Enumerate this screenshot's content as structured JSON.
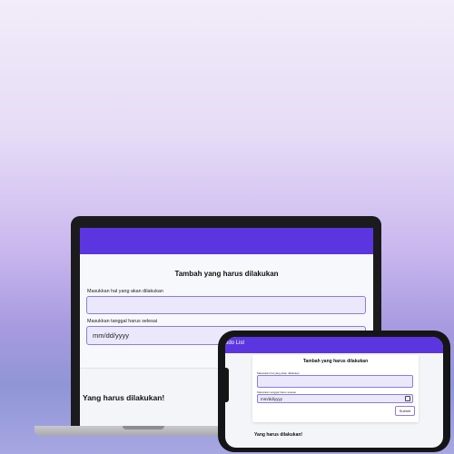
{
  "laptop": {
    "form_title": "Tambah yang harus dilakukan",
    "task_label": "Masukkan hal yang akan dilakukan",
    "task_value": "",
    "date_label": "Masukkan tanggal harus selesai",
    "date_placeholder": "mm/dd/yyyy",
    "list_title": "Yang harus dilakukan!"
  },
  "phone": {
    "header_title": "odo List",
    "form_title": "Tambah yang harus dilakukan",
    "task_label": "Masukkan hal yang akan dilakukan",
    "date_label": "Masukkan tanggal harus selesai",
    "date_placeholder": "mm/dd/yyyy",
    "submit_label": "Submit",
    "list_title": "Yang harus dilakukan!"
  },
  "colors": {
    "accent": "#5b36e0",
    "input_bg": "#ece8fb",
    "input_border": "#8d7be0"
  }
}
